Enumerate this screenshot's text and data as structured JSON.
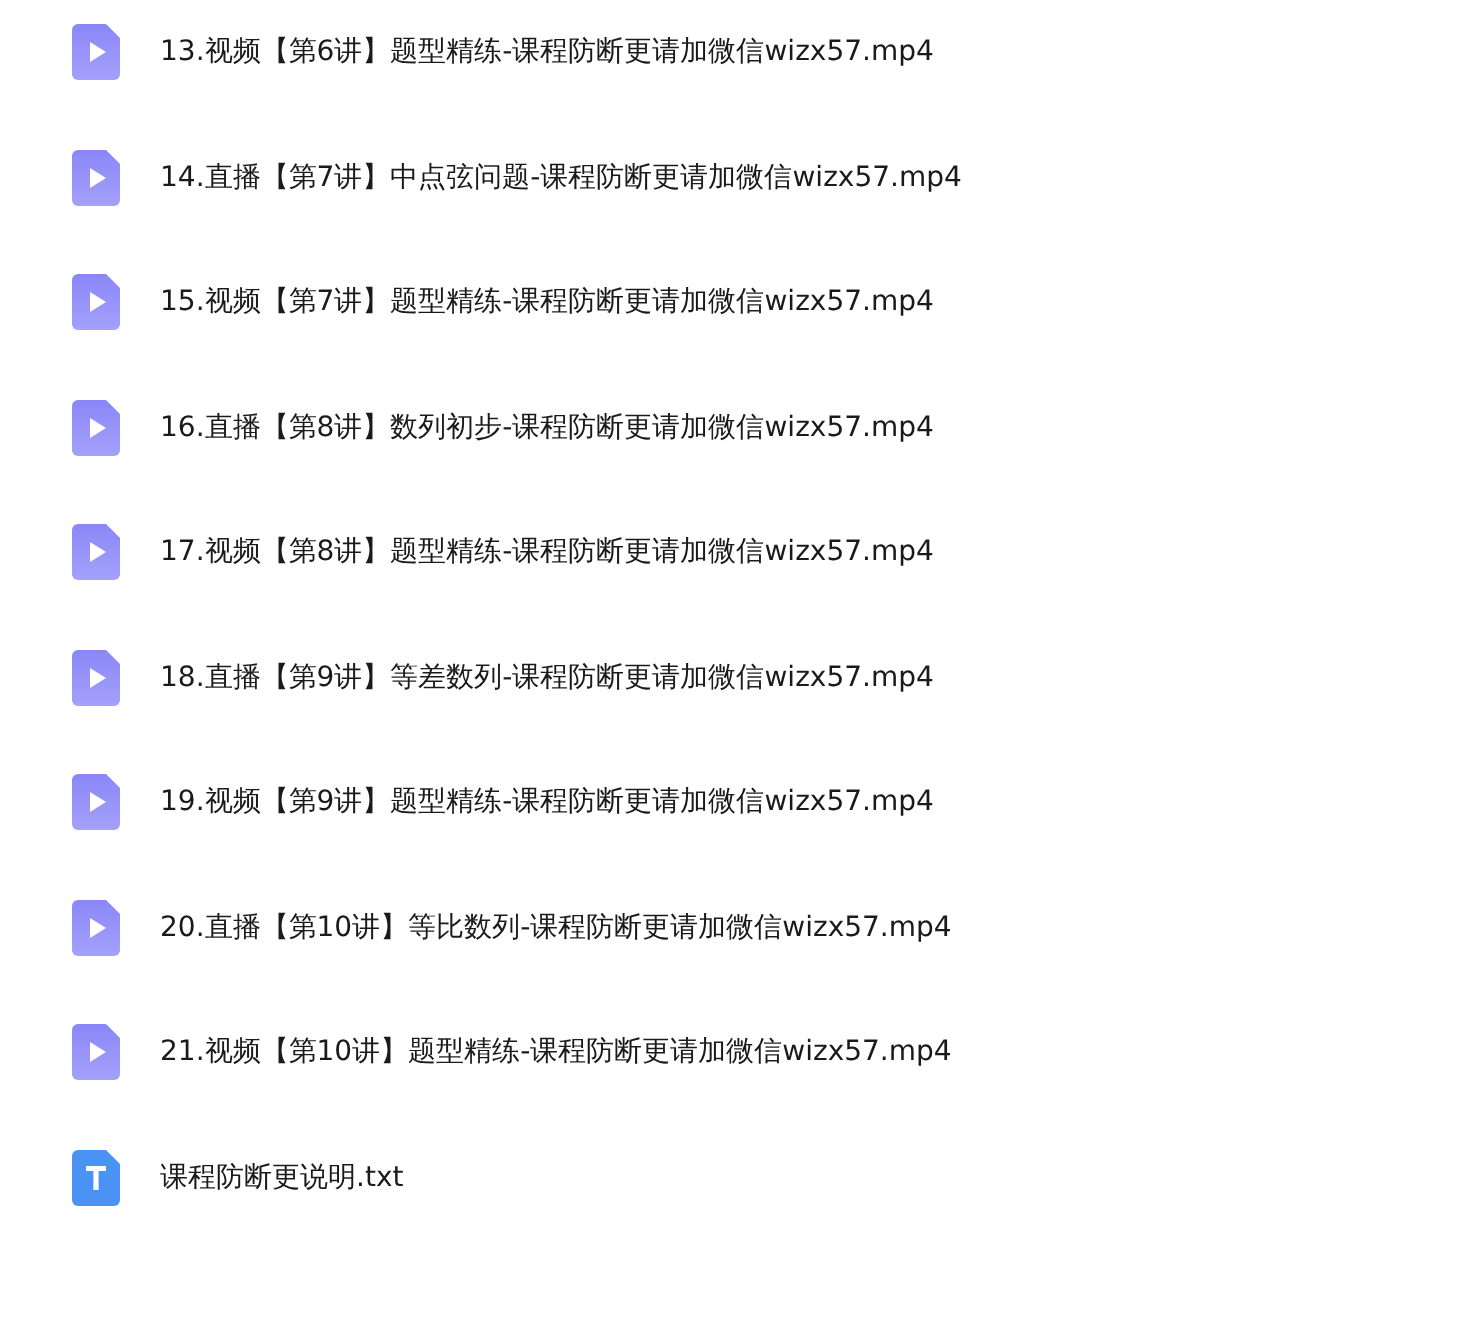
{
  "files": [
    {
      "name": "13.视频【第6讲】题型精练-课程防断更请加微信wizx57.mp4",
      "kind": "video"
    },
    {
      "name": "14.直播【第7讲】中点弦问题-课程防断更请加微信wizx57.mp4",
      "kind": "video"
    },
    {
      "name": "15.视频【第7讲】题型精练-课程防断更请加微信wizx57.mp4",
      "kind": "video"
    },
    {
      "name": "16.直播【第8讲】数列初步-课程防断更请加微信wizx57.mp4",
      "kind": "video"
    },
    {
      "name": "17.视频【第8讲】题型精练-课程防断更请加微信wizx57.mp4",
      "kind": "video"
    },
    {
      "name": "18.直播【第9讲】等差数列-课程防断更请加微信wizx57.mp4",
      "kind": "video"
    },
    {
      "name": "19.视频【第9讲】题型精练-课程防断更请加微信wizx57.mp4",
      "kind": "video"
    },
    {
      "name": "20.直播【第10讲】等比数列-课程防断更请加微信wizx57.mp4",
      "kind": "video"
    },
    {
      "name": "21.视频【第10讲】题型精练-课程防断更请加微信wizx57.mp4",
      "kind": "video"
    },
    {
      "name": "课程防断更说明.txt",
      "kind": "text"
    }
  ]
}
